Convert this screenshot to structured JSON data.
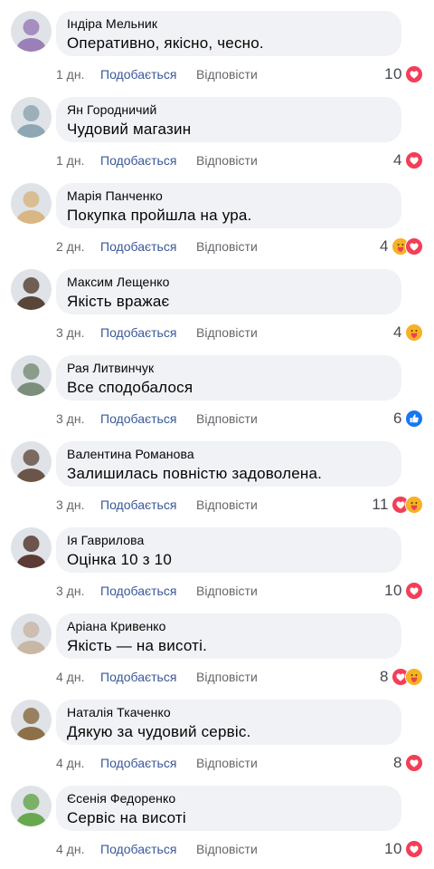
{
  "comments": [
    {
      "author": "Індіра Мельник",
      "text": "Оперативно, якісно, чесно.",
      "time": "1 дн.",
      "like": "Подобається",
      "reply": "Відповісти",
      "count": "10",
      "reactions": [
        "love"
      ],
      "avatar_color": "#9b7fb8"
    },
    {
      "author": "Ян Городничий",
      "text": "Чудовий магазин",
      "time": "1 дн.",
      "like": "Подобається",
      "reply": "Відповісти",
      "count": "4",
      "reactions": [
        "love"
      ],
      "avatar_color": "#8fa7b3"
    },
    {
      "author": "Марія Панченко",
      "text": "Покупка пройшла на ура.",
      "time": "2 дн.",
      "like": "Подобається",
      "reply": "Відповісти",
      "count": "4",
      "reactions": [
        "care",
        "love"
      ],
      "avatar_color": "#d8b784"
    },
    {
      "author": "Максим Лещенко",
      "text": "Якість вражає",
      "time": "3 дн.",
      "like": "Подобається",
      "reply": "Відповісти",
      "count": "4",
      "reactions": [
        "care"
      ],
      "avatar_color": "#5a4638"
    },
    {
      "author": "Рая Литвинчук",
      "text": "Все сподобалося",
      "time": "3 дн.",
      "like": "Подобається",
      "reply": "Відповісти",
      "count": "6",
      "reactions": [
        "like"
      ],
      "avatar_color": "#7c8f7a"
    },
    {
      "author": "Валентина Романова",
      "text": "Залишилась повністю задоволена.",
      "time": "3 дн.",
      "like": "Подобається",
      "reply": "Відповісти",
      "count": "11",
      "reactions": [
        "love",
        "care"
      ],
      "avatar_color": "#6b5548"
    },
    {
      "author": "Ія Гаврилова",
      "text": "Оцінка 10 з 10",
      "time": "3 дн.",
      "like": "Подобається",
      "reply": "Відповісти",
      "count": "10",
      "reactions": [
        "love"
      ],
      "avatar_color": "#5b3b33"
    },
    {
      "author": "Аріана Кривенко",
      "text": "Якість — на висоті.",
      "time": "4 дн.",
      "like": "Подобається",
      "reply": "Відповісти",
      "count": "8",
      "reactions": [
        "love",
        "care"
      ],
      "avatar_color": "#c9b7a6"
    },
    {
      "author": "Наталія Ткаченко",
      "text": "Дякую за чудовий сервіс.",
      "time": "4 дн.",
      "like": "Подобається",
      "reply": "Відповісти",
      "count": "8",
      "reactions": [
        "love"
      ],
      "avatar_color": "#8d7047"
    },
    {
      "author": "Єсенія Федоренко",
      "text": "Сервіс на висоті",
      "time": "4 дн.",
      "like": "Подобається",
      "reply": "Відповісти",
      "count": "10",
      "reactions": [
        "love"
      ],
      "avatar_color": "#6aa84f"
    }
  ],
  "colors": {
    "bubble": "#f0f2f5",
    "like_link": "#385898",
    "meta": "#65676b",
    "love": "#f33e58",
    "like": "#1877f2",
    "care": "#f7b125"
  },
  "icons": {
    "love": "heart-reaction-icon",
    "like": "thumbs-up-reaction-icon",
    "care": "care-hug-reaction-icon"
  }
}
